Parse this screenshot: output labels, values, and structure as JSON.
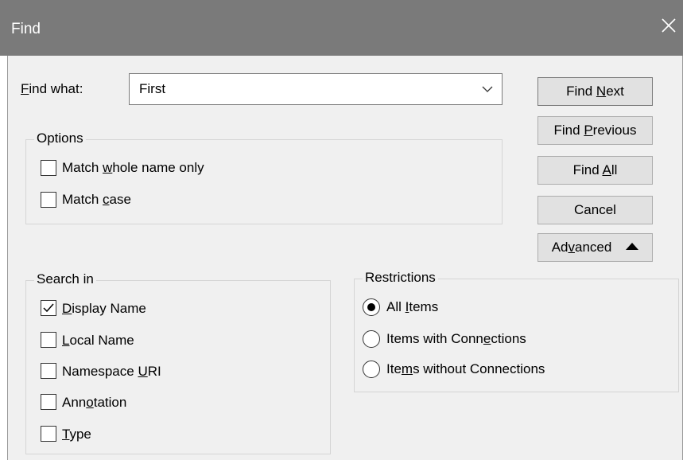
{
  "window": {
    "title": "Find",
    "close_icon": "close-icon"
  },
  "find_what": {
    "label_pre": "",
    "label_ul": "F",
    "label_post": "ind what:",
    "value": "First"
  },
  "options": {
    "title": "Options",
    "items": [
      {
        "pre": "Match ",
        "ul": "w",
        "post": "hole name only",
        "checked": false
      },
      {
        "pre": "Match ",
        "ul": "c",
        "post": "ase",
        "checked": false
      }
    ]
  },
  "buttons": {
    "find_next": {
      "pre": "Find ",
      "ul": "N",
      "post": "ext"
    },
    "find_previous": {
      "pre": "Find ",
      "ul": "P",
      "post": "revious"
    },
    "find_all": {
      "pre": "Find ",
      "ul": "A",
      "post": "ll"
    },
    "cancel": {
      "label": "Cancel"
    },
    "advanced": {
      "pre": "Ad",
      "ul": "v",
      "post": "anced",
      "icon": "caret-up-icon"
    }
  },
  "search_in": {
    "title": "Search in",
    "items": [
      {
        "pre": "",
        "ul": "D",
        "post": "isplay Name",
        "checked": true
      },
      {
        "pre": "",
        "ul": "L",
        "post": "ocal Name",
        "checked": false
      },
      {
        "pre": "Namespace ",
        "ul": "U",
        "post": "RI",
        "checked": false
      },
      {
        "pre": "Ann",
        "ul": "o",
        "post": "tation",
        "checked": false
      },
      {
        "pre": "",
        "ul": "T",
        "post": "ype",
        "checked": false
      }
    ]
  },
  "restrictions": {
    "title": "Restrictions",
    "items": [
      {
        "pre": "All ",
        "ul": "I",
        "post": "tems",
        "selected": true
      },
      {
        "pre": "Items with Conn",
        "ul": "e",
        "post": "ctions",
        "selected": false
      },
      {
        "pre": "Ite",
        "ul": "m",
        "post": "s without Connections",
        "selected": false
      }
    ]
  }
}
